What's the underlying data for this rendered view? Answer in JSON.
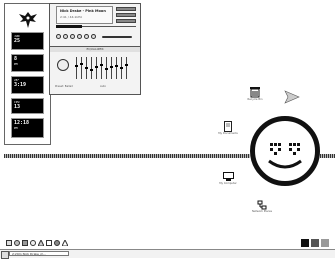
{
  "dashboard": {
    "widgets": [
      {
        "line1": "JUN",
        "line2": "25",
        "line3": "12"
      },
      {
        "line1": "8",
        "line2": "PM",
        "line3": ""
      },
      {
        "line1": "28°",
        "line2": "3:19",
        "line3": ""
      },
      {
        "line1": "CPU",
        "line2": "13",
        "line3": "MEM"
      },
      {
        "line1": "",
        "line2": "",
        "line3": ""
      },
      {
        "line1": "12:18",
        "line2": "PM",
        "line3": ""
      }
    ]
  },
  "player": {
    "track_title": "Nick Drake - Pink Moon",
    "track_meta": "2:41 / 44.1kHz"
  },
  "equalizer": {
    "title": "EQUALIZER",
    "preset_label": "Preset: Ballad",
    "mode_label": "Auto"
  },
  "desktop_icons": [
    {
      "id": "recycle",
      "label": "Recycle Bin"
    },
    {
      "id": "documents",
      "label": "My Documents"
    },
    {
      "id": "computer",
      "label": "My Computer"
    },
    {
      "id": "network",
      "label": "Network Places"
    }
  ],
  "taskbar": {
    "task_label": "2:29m  Nick Drake_m..."
  },
  "colors": {
    "background": "#ffffff",
    "ink": "#111111"
  }
}
